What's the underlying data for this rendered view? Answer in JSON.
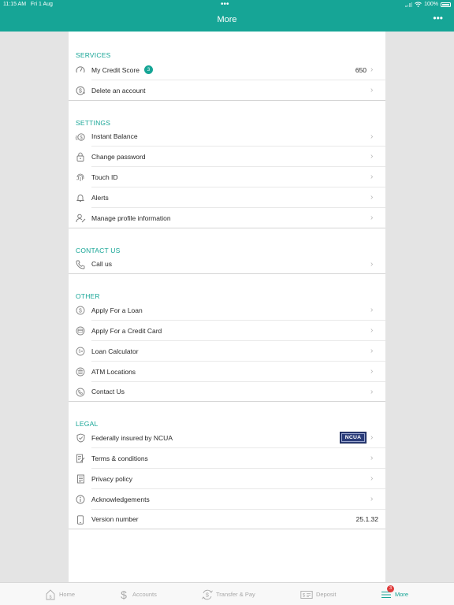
{
  "status": {
    "time": "11:15 AM",
    "date": "Fri 1 Aug",
    "dots": "•••",
    "battery": "100%"
  },
  "header": {
    "title": "More",
    "menu_icon": "•••"
  },
  "sections": [
    {
      "title": "SERVICES",
      "rows": [
        {
          "label": "My Credit Score",
          "badge": "3",
          "value": "650"
        },
        {
          "label": "Delete an account"
        }
      ]
    },
    {
      "title": "SETTINGS",
      "rows": [
        {
          "label": "Instant Balance"
        },
        {
          "label": "Change password"
        },
        {
          "label": "Touch ID"
        },
        {
          "label": "Alerts"
        },
        {
          "label": "Manage profile information"
        }
      ]
    },
    {
      "title": "CONTACT US",
      "rows": [
        {
          "label": "Call us"
        }
      ]
    },
    {
      "title": "OTHER",
      "rows": [
        {
          "label": "Apply For a Loan"
        },
        {
          "label": "Apply For a Credit Card"
        },
        {
          "label": "Loan Calculator"
        },
        {
          "label": "ATM Locations"
        },
        {
          "label": "Contact Us"
        }
      ]
    },
    {
      "title": "LEGAL",
      "rows": [
        {
          "label": "Federally insured by NCUA",
          "logo": "NCUA"
        },
        {
          "label": "Terms & conditions"
        },
        {
          "label": "Privacy policy"
        },
        {
          "label": "Acknowledgements"
        },
        {
          "label": "Version number",
          "value": "25.1.32"
        }
      ]
    }
  ],
  "tabs": [
    {
      "label": "Home",
      "icon": "home-icon"
    },
    {
      "label": "Accounts",
      "icon": "dollar-icon"
    },
    {
      "label": "Transfer & Pay",
      "icon": "transfer-icon"
    },
    {
      "label": "Deposit",
      "icon": "check-deposit-icon"
    },
    {
      "label": "More",
      "icon": "menu-icon",
      "badge": "3"
    }
  ],
  "colors": {
    "accent": "#16a596",
    "badge_red": "#e03b3b",
    "ncua_blue": "#2b3d7a"
  }
}
